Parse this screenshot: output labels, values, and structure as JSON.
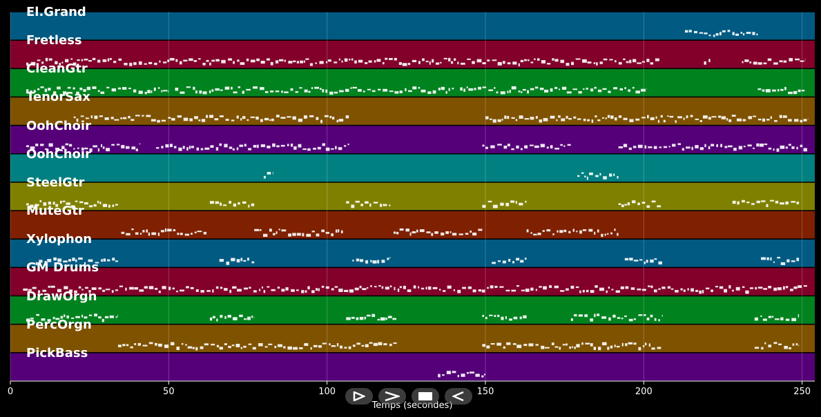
{
  "chart_data": {
    "type": "piano-roll",
    "xlabel": "Temps (secondes)",
    "xlim": [
      0,
      254
    ],
    "xticks": [
      0,
      50,
      100,
      150,
      200,
      250
    ],
    "grid": true,
    "tracks": [
      {
        "name": "El.Grand",
        "color": "#005a82",
        "segments": [
          [
            213,
            236
          ]
        ]
      },
      {
        "name": "Fretless",
        "color": "#82002a",
        "segments": [
          [
            5,
            205
          ],
          [
            219,
            221
          ],
          [
            231,
            251
          ]
        ]
      },
      {
        "name": "CleanGtr",
        "color": "#00821f",
        "segments": [
          [
            5,
            50
          ],
          [
            52,
            140
          ],
          [
            142,
            201
          ],
          [
            236,
            251
          ]
        ]
      },
      {
        "name": "TenorSax",
        "color": "#7f5200",
        "segments": [
          [
            20,
            107
          ],
          [
            150,
            252
          ]
        ]
      },
      {
        "name": "OohChoir",
        "color": "#550079",
        "segments": [
          [
            5,
            41
          ],
          [
            46,
            107
          ],
          [
            149,
            177
          ],
          [
            192,
            252
          ]
        ]
      },
      {
        "name": "OohChoir",
        "color": "#008080",
        "segments": [
          [
            80,
            83
          ],
          [
            179,
            192
          ]
        ]
      },
      {
        "name": "SteelGtr",
        "color": "#808000",
        "segments": [
          [
            5,
            34
          ],
          [
            63,
            77
          ],
          [
            106,
            120
          ],
          [
            149,
            163
          ],
          [
            192,
            206
          ],
          [
            228,
            249
          ]
        ]
      },
      {
        "name": "MuteGtr",
        "color": "#7f2000",
        "segments": [
          [
            35,
            62
          ],
          [
            77,
            105
          ],
          [
            121,
            149
          ],
          [
            163,
            192
          ]
        ]
      },
      {
        "name": "Xylophon",
        "color": "#005a82",
        "segments": [
          [
            8,
            34
          ],
          [
            66,
            77
          ],
          [
            108,
            120
          ],
          [
            152,
            163
          ],
          [
            194,
            206
          ],
          [
            237,
            249
          ]
        ]
      },
      {
        "name": "GM Drums",
        "color": "#82002a",
        "segments": [
          [
            4,
            252
          ]
        ]
      },
      {
        "name": "DrawOrgn",
        "color": "#00821f",
        "segments": [
          [
            5,
            34
          ],
          [
            63,
            77
          ],
          [
            106,
            122
          ],
          [
            149,
            163
          ],
          [
            177,
            206
          ],
          [
            235,
            249
          ]
        ]
      },
      {
        "name": "PercOrgn",
        "color": "#7f5200",
        "segments": [
          [
            34,
            122
          ],
          [
            149,
            206
          ],
          [
            235,
            249
          ]
        ]
      },
      {
        "name": "PickBass",
        "color": "#550079",
        "segments": [
          [
            135,
            150
          ]
        ]
      }
    ]
  }
}
